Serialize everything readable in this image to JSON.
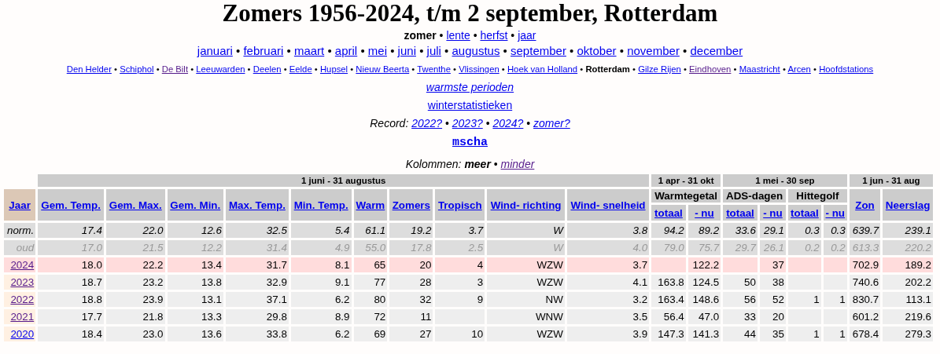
{
  "title": "Zomers 1956-2024, t/m 2 september, Rotterdam",
  "separator": "•",
  "season_nav": [
    {
      "label": "zomer",
      "current": true
    },
    {
      "label": "lente",
      "current": false
    },
    {
      "label": "herfst",
      "current": false
    },
    {
      "label": "jaar",
      "current": false
    }
  ],
  "month_nav": [
    "januari",
    "februari",
    "maart",
    "april",
    "mei",
    "juni",
    "juli",
    "augustus",
    "september",
    "oktober",
    "november",
    "december"
  ],
  "station_nav": [
    {
      "label": "Den Helder",
      "current": false,
      "visited": false
    },
    {
      "label": "Schiphol",
      "current": false,
      "visited": false
    },
    {
      "label": "De Bilt",
      "current": false,
      "visited": true
    },
    {
      "label": "Leeuwarden",
      "current": false,
      "visited": false
    },
    {
      "label": "Deelen",
      "current": false,
      "visited": false
    },
    {
      "label": "Eelde",
      "current": false,
      "visited": false
    },
    {
      "label": "Hupsel",
      "current": false,
      "visited": false
    },
    {
      "label": "Nieuw Beerta",
      "current": false,
      "visited": false
    },
    {
      "label": "Twenthe",
      "current": false,
      "visited": false
    },
    {
      "label": "Vlissingen",
      "current": false,
      "visited": false
    },
    {
      "label": "Hoek van Holland",
      "current": false,
      "visited": false
    },
    {
      "label": "Rotterdam",
      "current": true
    },
    {
      "label": "Gilze Rijen",
      "current": false,
      "visited": false
    },
    {
      "label": "Eindhoven",
      "current": false,
      "visited": true
    },
    {
      "label": "Maastricht",
      "current": false,
      "visited": false
    },
    {
      "label": "Arcen",
      "current": false,
      "visited": false
    },
    {
      "label": "Hoofdstations",
      "current": false,
      "visited": false
    }
  ],
  "warmest_link": "warmste perioden",
  "winter_link": "winterstatistieken",
  "record": {
    "label": "Record:",
    "links": [
      "2022?",
      "2023?",
      "2024?",
      "zomer?"
    ]
  },
  "author_link": "mscha",
  "columns_toggle": {
    "label": "Kolommen:",
    "options": [
      {
        "label": "meer",
        "selected": true
      },
      {
        "label": "minder",
        "selected": false,
        "visited": true
      }
    ]
  },
  "table": {
    "year_header": "Jaar",
    "groups": [
      {
        "label": "1 juni - 31 augustus",
        "columns": [
          "Gem. Temp.",
          "Gem. Max.",
          "Gem. Min.",
          "Max. Temp.",
          "Min. Temp.",
          "Warm",
          "Zomers",
          "Tropisch",
          "Wind- richting",
          "Wind- snelheid"
        ]
      },
      {
        "label": "1 apr - 31 okt",
        "subgroups": [
          {
            "label": "Warmtegetal",
            "columns": [
              "totaal",
              "- nu"
            ]
          }
        ]
      },
      {
        "label": "1 mei - 30 sep",
        "subgroups": [
          {
            "label": "ADS-dagen",
            "columns": [
              "totaal",
              "- nu"
            ]
          },
          {
            "label": "Hittegolf",
            "columns": [
              "totaal",
              "- nu"
            ]
          }
        ]
      },
      {
        "label": "1 jun - 31 aug",
        "columns": [
          "Zon",
          "Neerslag"
        ]
      }
    ],
    "rows": [
      {
        "kind": "norm",
        "label": "norm.",
        "cells": [
          "17.4",
          "22.0",
          "12.6",
          "32.5",
          "5.4",
          "61.1",
          "19.2",
          "3.7",
          "W",
          "3.8",
          "94.2",
          "89.2",
          "33.6",
          "29.1",
          "0.3",
          "0.3",
          "639.7",
          "239.1"
        ]
      },
      {
        "kind": "old",
        "label": "oud",
        "cells": [
          "17.0",
          "21.5",
          "12.2",
          "31.4",
          "4.9",
          "55.0",
          "17.8",
          "2.5",
          "W",
          "4.0",
          "79.0",
          "75.7",
          "29.7",
          "26.1",
          "0.2",
          "0.2",
          "613.3",
          "220.2"
        ]
      },
      {
        "kind": "current",
        "label": "2024",
        "visited": true,
        "cells": [
          "18.0",
          "22.2",
          "13.4",
          "31.7",
          "8.1",
          "65",
          "20",
          "4",
          "WZW",
          "3.7",
          null,
          "122.2",
          null,
          "37",
          null,
          null,
          "702.9",
          "189.2"
        ]
      },
      {
        "kind": "year",
        "label": "2023",
        "visited": true,
        "cells": [
          "18.7",
          "23.2",
          "13.8",
          "32.9",
          "9.1",
          "77",
          "28",
          "3",
          "WZW",
          "4.1",
          "163.8",
          "124.5",
          "50",
          "38",
          null,
          null,
          "740.6",
          "202.2"
        ]
      },
      {
        "kind": "year",
        "label": "2022",
        "visited": true,
        "cells": [
          "18.8",
          "23.9",
          "13.1",
          "37.1",
          "6.2",
          "80",
          "32",
          "9",
          "NW",
          "3.2",
          "163.4",
          "148.6",
          "56",
          "52",
          "1",
          "1",
          "830.7",
          "113.1"
        ]
      },
      {
        "kind": "year",
        "label": "2021",
        "visited": true,
        "cells": [
          "17.7",
          "21.8",
          "13.3",
          "29.8",
          "8.9",
          "72",
          "11",
          null,
          "WNW",
          "3.5",
          "56.4",
          "47.0",
          "33",
          "20",
          null,
          null,
          "601.2",
          "219.6"
        ]
      },
      {
        "kind": "year",
        "label": "2020",
        "visited": false,
        "cells": [
          "18.4",
          "23.0",
          "13.6",
          "33.8",
          "6.2",
          "69",
          "27",
          "10",
          "WZW",
          "3.9",
          "147.3",
          "141.3",
          "44",
          "35",
          "1",
          "1",
          "678.4",
          "279.3"
        ]
      }
    ]
  }
}
